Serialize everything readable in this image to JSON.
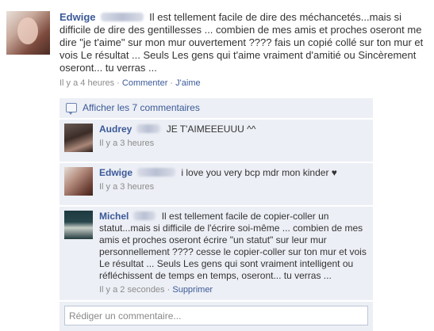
{
  "post": {
    "author": "Edwige",
    "text": "Il est tellement facile de dire des méchancetés...mais si difficile de dire des gentillesses ... combien de mes amis et proches oseront me dire \"je t'aime\" sur mon mur ouvertement ???? fais un copié collé sur ton mur et vois Le résultat ... Seuls Les gens qui t'aime vraiment d'amitié ou Sincèrement oseront... tu verras ...",
    "time": "Il y a 4 heures",
    "separator": "·",
    "comment_label": "Commenter",
    "like_label": "J'aime"
  },
  "comments": {
    "show_all_label": "Afficher les 7 commentaires",
    "items": [
      {
        "author": "Audrey",
        "text": "JE T'AIMEEEUUU ^^",
        "time": "Il y a 3 heures"
      },
      {
        "author": "Edwige",
        "text": "i love you very bcp mdr mon kinder ♥",
        "time": "Il y a 3 heures"
      },
      {
        "author": "Michel",
        "text": "Il est tellement facile de copier-coller un statut...mais si difficile de l'écrire soi-même ... combien de mes amis et proches oseront écrire \"un statut\" sur leur mur personnellement ???? cesse le copier-coller sur ton mur et vois Le résultat ... Seuls Les gens qui sont vraiment intelligent ou réfléchissent de temps en temps, oseront... tu verras ...",
        "time": "Il y a 2 secondes",
        "delete_label": "Supprimer"
      }
    ],
    "composer_placeholder": "Rédiger un commentaire..."
  }
}
